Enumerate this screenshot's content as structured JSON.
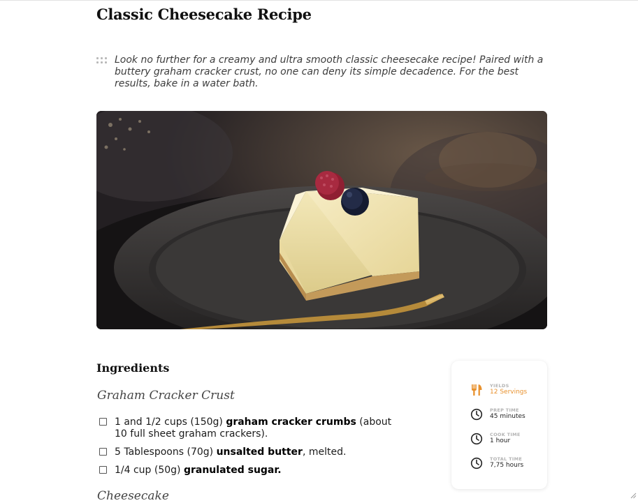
{
  "recipe": {
    "title": "Classic Cheesecake Recipe",
    "description": "Look no further for a creamy and ultra smooth classic cheesecake recipe! Paired with a buttery graham cracker crust, no one can deny its simple decadence. For the best results, bake in a water bath."
  },
  "ingredients": {
    "heading": "Ingredients",
    "groups": [
      {
        "name": "Graham Cracker Crust",
        "items": [
          {
            "pre": "1 and 1/2 cups (150g) ",
            "bold": "graham cracker crumbs",
            "post": " (about 10 full sheet graham crackers)."
          },
          {
            "pre": "5 Tablespoons (70g) ",
            "bold": "unsalted butter",
            "post": ", melted."
          },
          {
            "pre": "1/4 cup (50g) ",
            "bold": "granulated sugar.",
            "post": ""
          }
        ]
      },
      {
        "name": "Cheesecake"
      }
    ]
  },
  "info": {
    "yields": {
      "label": "YIELDS",
      "value": "12 Servings",
      "icon": "utensils-icon"
    },
    "prep": {
      "label": "PREP TIME",
      "value": "45 minutes",
      "icon": "clock-icon"
    },
    "cook": {
      "label": "COOK TIME",
      "value": "1 hour",
      "icon": "clock-icon"
    },
    "total": {
      "label": "TOTAL TIME",
      "value": "7,75 hours",
      "icon": "clock-icon"
    }
  },
  "colors": {
    "accent": "#e8912d",
    "text": "#111111",
    "muted": "#b3b3b3"
  }
}
